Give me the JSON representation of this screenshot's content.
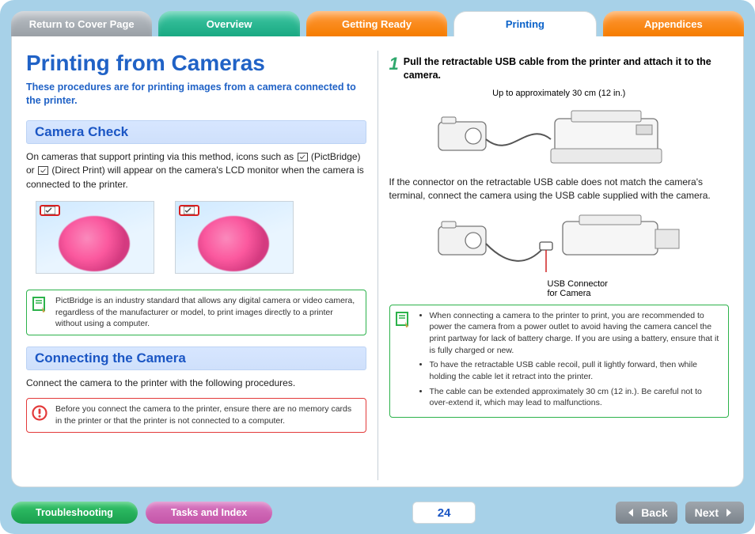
{
  "tabs": {
    "return": "Return to Cover Page",
    "overview": "Overview",
    "ready": "Getting Ready",
    "printing": "Printing",
    "appendices": "Appendices"
  },
  "title": "Printing from Cameras",
  "intro": "These procedures are for printing images from a camera connected to the printer.",
  "section1": {
    "heading": "Camera Check",
    "body_pre": "On cameras that support printing via this method, icons such as ",
    "body_mid": " (PictBridge) or ",
    "body_post": " (Direct Print) will appear on the camera's LCD monitor when the camera is connected to the printer.",
    "note": "PictBridge is an industry standard that allows any digital camera or video camera, regardless of the manufacturer or model, to print images directly to a printer without using a computer."
  },
  "section2": {
    "heading": "Connecting the Camera",
    "body": "Connect the camera to the printer with the following procedures.",
    "warn": "Before you connect the camera to the printer, ensure there are no memory cards in the printer or that the printer is not connected to a computer."
  },
  "step1": {
    "num": "1",
    "text": "Pull the retractable USB cable from the printer and attach it to the camera.",
    "cap_top": "Up to approximately 30 cm (12 in.)",
    "body2": "If the connector on the retractable USB cable does not match the camera's terminal, connect the camera using the USB cable supplied with the camera.",
    "cap_bottom_l1": "USB Connector",
    "cap_bottom_l2": "for Camera",
    "tips": [
      "When connecting a camera to the printer to print, you are recommended to power the camera from a power outlet to avoid having the camera cancel the print partway for lack of battery charge. If you are using a battery, ensure that it is fully charged or new.",
      "To have the retractable USB cable recoil, pull it lightly forward, then while holding the cable let it retract into the printer.",
      "The cable can be extended approximately 30 cm (12 in.). Be careful not to over-extend it, which may lead to malfunctions."
    ]
  },
  "bottom": {
    "trouble": "Troubleshooting",
    "tasks": "Tasks and Index",
    "page": "24",
    "back": "Back",
    "next": "Next"
  }
}
